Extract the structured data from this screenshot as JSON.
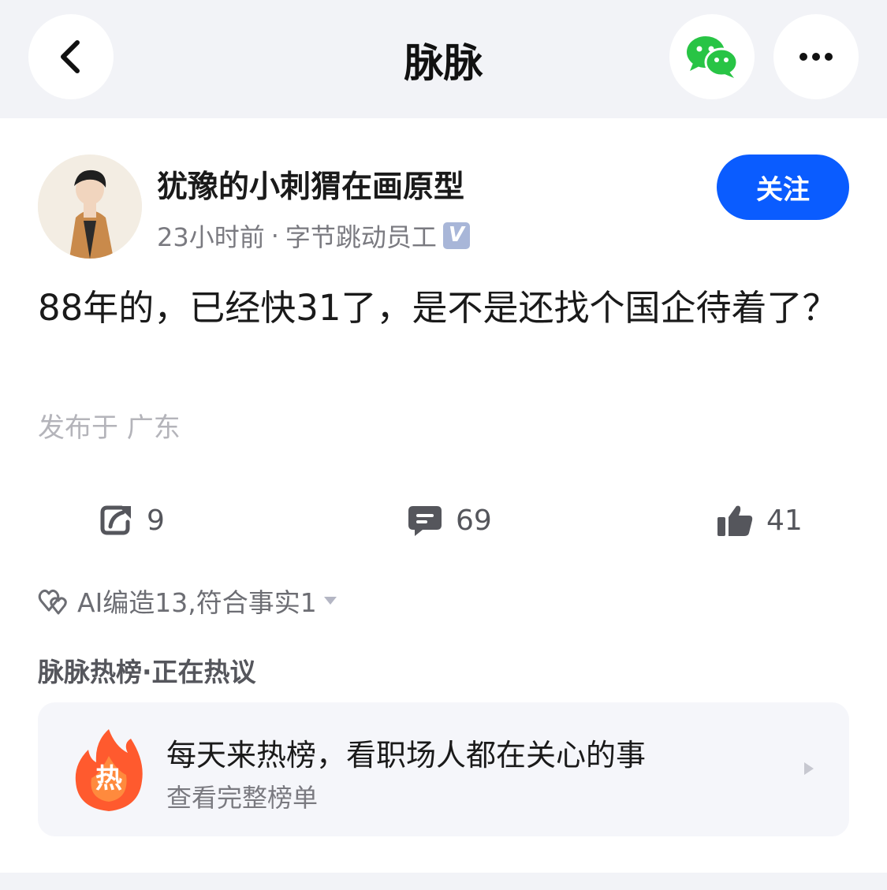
{
  "nav": {
    "title": "脉脉",
    "back_icon": "chevron-left-icon",
    "share_icon": "wechat-icon",
    "more_icon": "more-dots-icon"
  },
  "post": {
    "author": "犹豫的小刺猬在画原型",
    "time": "23小时前",
    "separator": "·",
    "company": "字节跳动员工",
    "verified_badge": "V",
    "follow_label": "关注",
    "content": "88年的，已经快31了，是不是还找个国企待着了？",
    "location": "发布于 广东"
  },
  "stats": {
    "shares": "9",
    "comments": "69",
    "likes": "41"
  },
  "ai": {
    "summary": "AI编造13,符合事实1"
  },
  "hot": {
    "heading": "脉脉热榜·正在热议",
    "badge": "热",
    "title": "每天来热榜，看职场人都在关心的事",
    "subtitle": "查看完整榜单"
  },
  "colors": {
    "accent": "#0a5cff",
    "wechat_green": "#28c445",
    "flame_orange": "#ff5a2e"
  }
}
